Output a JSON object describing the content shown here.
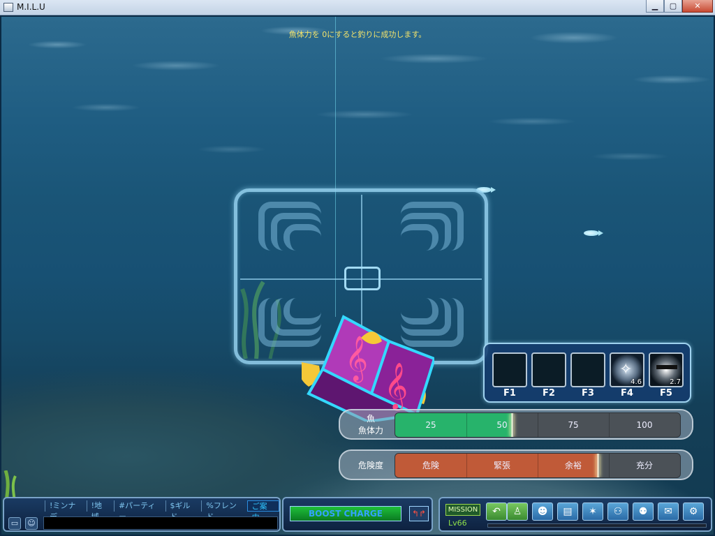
{
  "window": {
    "title": "M.I.L.U",
    "minimize": "▁",
    "maximize": "▢",
    "close": "✕"
  },
  "hint": "魚体力を 0にすると釣りに成功します。",
  "skills": [
    {
      "key": "F1",
      "count": ""
    },
    {
      "key": "F2",
      "count": ""
    },
    {
      "key": "F3",
      "count": ""
    },
    {
      "key": "F4",
      "count": "4.6",
      "icon": "fishing-lure-icon"
    },
    {
      "key": "F5",
      "count": "2.7",
      "icon": "fishing-reel-icon"
    }
  ],
  "fish_stamina": {
    "label_top": "魚",
    "label_bottom": "魚体力",
    "ticks": [
      "25",
      "50",
      "75",
      "100"
    ],
    "fill_fraction": 0.41,
    "fill_color": "#27b36b"
  },
  "danger": {
    "label": "危険度",
    "ticks": [
      "危険",
      "緊張",
      "余裕",
      "充分"
    ],
    "fill_fraction": 0.71,
    "fill_color": "#c05a38"
  },
  "chat": {
    "tabs": [
      "!ミンナデ",
      "!地域",
      "#パーティー",
      "$ギルド",
      "%フレンド",
      "ご案内"
    ],
    "active_tab": 5
  },
  "boost": {
    "label": "BOOST CHARGE",
    "button": "↰↱"
  },
  "menu": {
    "mission": "MISSION",
    "level": "Lv66"
  }
}
